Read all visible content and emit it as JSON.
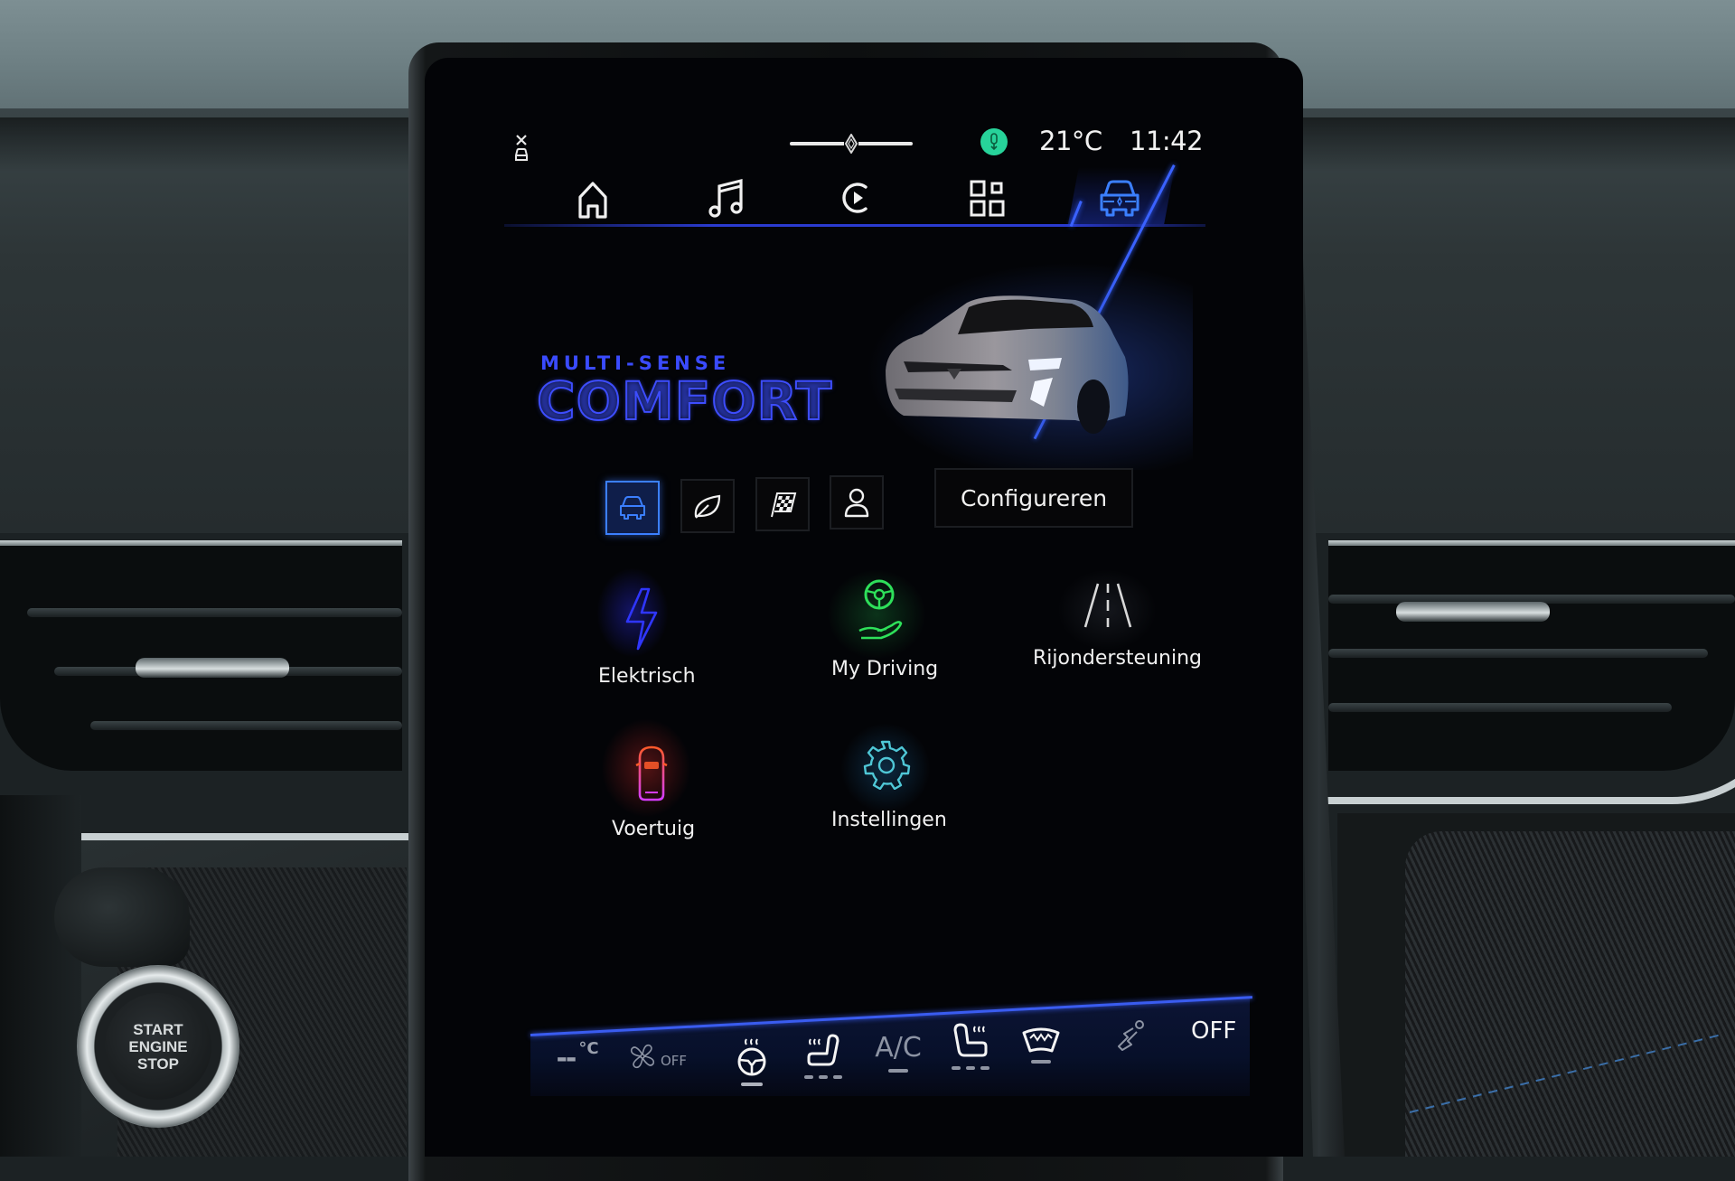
{
  "environment": {
    "start_button": {
      "line1": "START",
      "line2": "ENGINE",
      "line3": "STOP"
    }
  },
  "status_bar": {
    "left_icon": "car-lock-icon",
    "slider_icon": "renault-logo-icon",
    "mic_icon": "microphone-icon",
    "mic_color": "#27d39a",
    "temperature": "21°C",
    "time": "11:42"
  },
  "nav": {
    "active_index": 4,
    "active_color": "#3b7fff",
    "items": [
      {
        "name": "home",
        "icon": "home-icon"
      },
      {
        "name": "music",
        "icon": "music-note-icon"
      },
      {
        "name": "media",
        "icon": "play-circle-icon"
      },
      {
        "name": "apps",
        "icon": "apps-grid-icon"
      },
      {
        "name": "vehicle",
        "icon": "car-front-icon"
      }
    ]
  },
  "hero": {
    "eyebrow": "MULTI-SENSE",
    "mode_title": "COMFORT",
    "accent_color": "#3d4dff"
  },
  "modes": {
    "active_index": 0,
    "items": [
      {
        "name": "comfort",
        "icon": "car-front-icon"
      },
      {
        "name": "eco",
        "icon": "leaf-icon"
      },
      {
        "name": "sport",
        "icon": "checkered-flag-icon"
      },
      {
        "name": "perso",
        "icon": "person-icon"
      }
    ],
    "configure_label": "Configureren"
  },
  "apps": [
    {
      "label": "Elektrisch",
      "icon": "lightning-bolt-icon",
      "color": "#2f36ff"
    },
    {
      "label": "My Driving",
      "icon": "steering-wheel-hand-icon",
      "color": "#2ee05a"
    },
    {
      "label": "Rijondersteuning",
      "icon": "road-lanes-icon",
      "color": "#d8d8d8"
    },
    {
      "label": "Voertuig",
      "icon": "car-top-view-icon",
      "color": "#ff5a3a"
    },
    {
      "label": "Instellingen",
      "icon": "gear-icon",
      "color": "#4fc7d6"
    }
  ],
  "climate": {
    "temperature_value": "--",
    "temperature_unit": "°C",
    "fan_label": "OFF",
    "ac_label": "A/C",
    "power_label": "OFF",
    "items": [
      {
        "name": "heated-steering-wheel",
        "icon": "heated-steering-wheel-icon",
        "level": "1/1"
      },
      {
        "name": "heated-seat-left",
        "icon": "heated-seat-left-icon",
        "level": "0/3"
      },
      {
        "name": "ac",
        "icon": "ac-icon",
        "level": "0/1"
      },
      {
        "name": "heated-seat-right",
        "icon": "heated-seat-right-icon",
        "level": "0/3"
      },
      {
        "name": "windshield-defrost",
        "icon": "windshield-defrost-icon",
        "level": "0/1"
      },
      {
        "name": "air-distribution",
        "icon": "air-distribution-icon"
      }
    ]
  }
}
